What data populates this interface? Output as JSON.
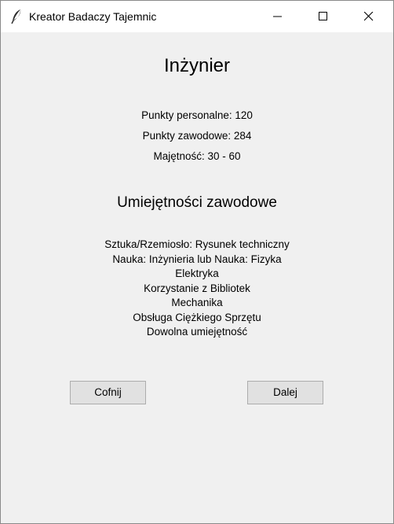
{
  "window": {
    "title": "Kreator Badaczy Tajemnic",
    "icons": {
      "app": "feather-icon",
      "minimize": "minimize-icon",
      "maximize": "maximize-icon",
      "close": "close-icon"
    }
  },
  "profession": {
    "name": "Inżynier",
    "personal_points": "Punkty personalne: 120",
    "occupation_points": "Punkty zawodowe: 284",
    "wealth": "Majętność: 30 - 60"
  },
  "skills": {
    "heading": "Umiejętności zawodowe",
    "items": [
      "Sztuka/Rzemiosło: Rysunek techniczny",
      "Nauka: Inżynieria lub Nauka: Fizyka",
      "Elektryka",
      "Korzystanie z Bibliotek",
      "Mechanika",
      "Obsługa Ciężkiego Sprzętu",
      "Dowolna umiejętność"
    ]
  },
  "buttons": {
    "back": "Cofnij",
    "next": "Dalej"
  }
}
